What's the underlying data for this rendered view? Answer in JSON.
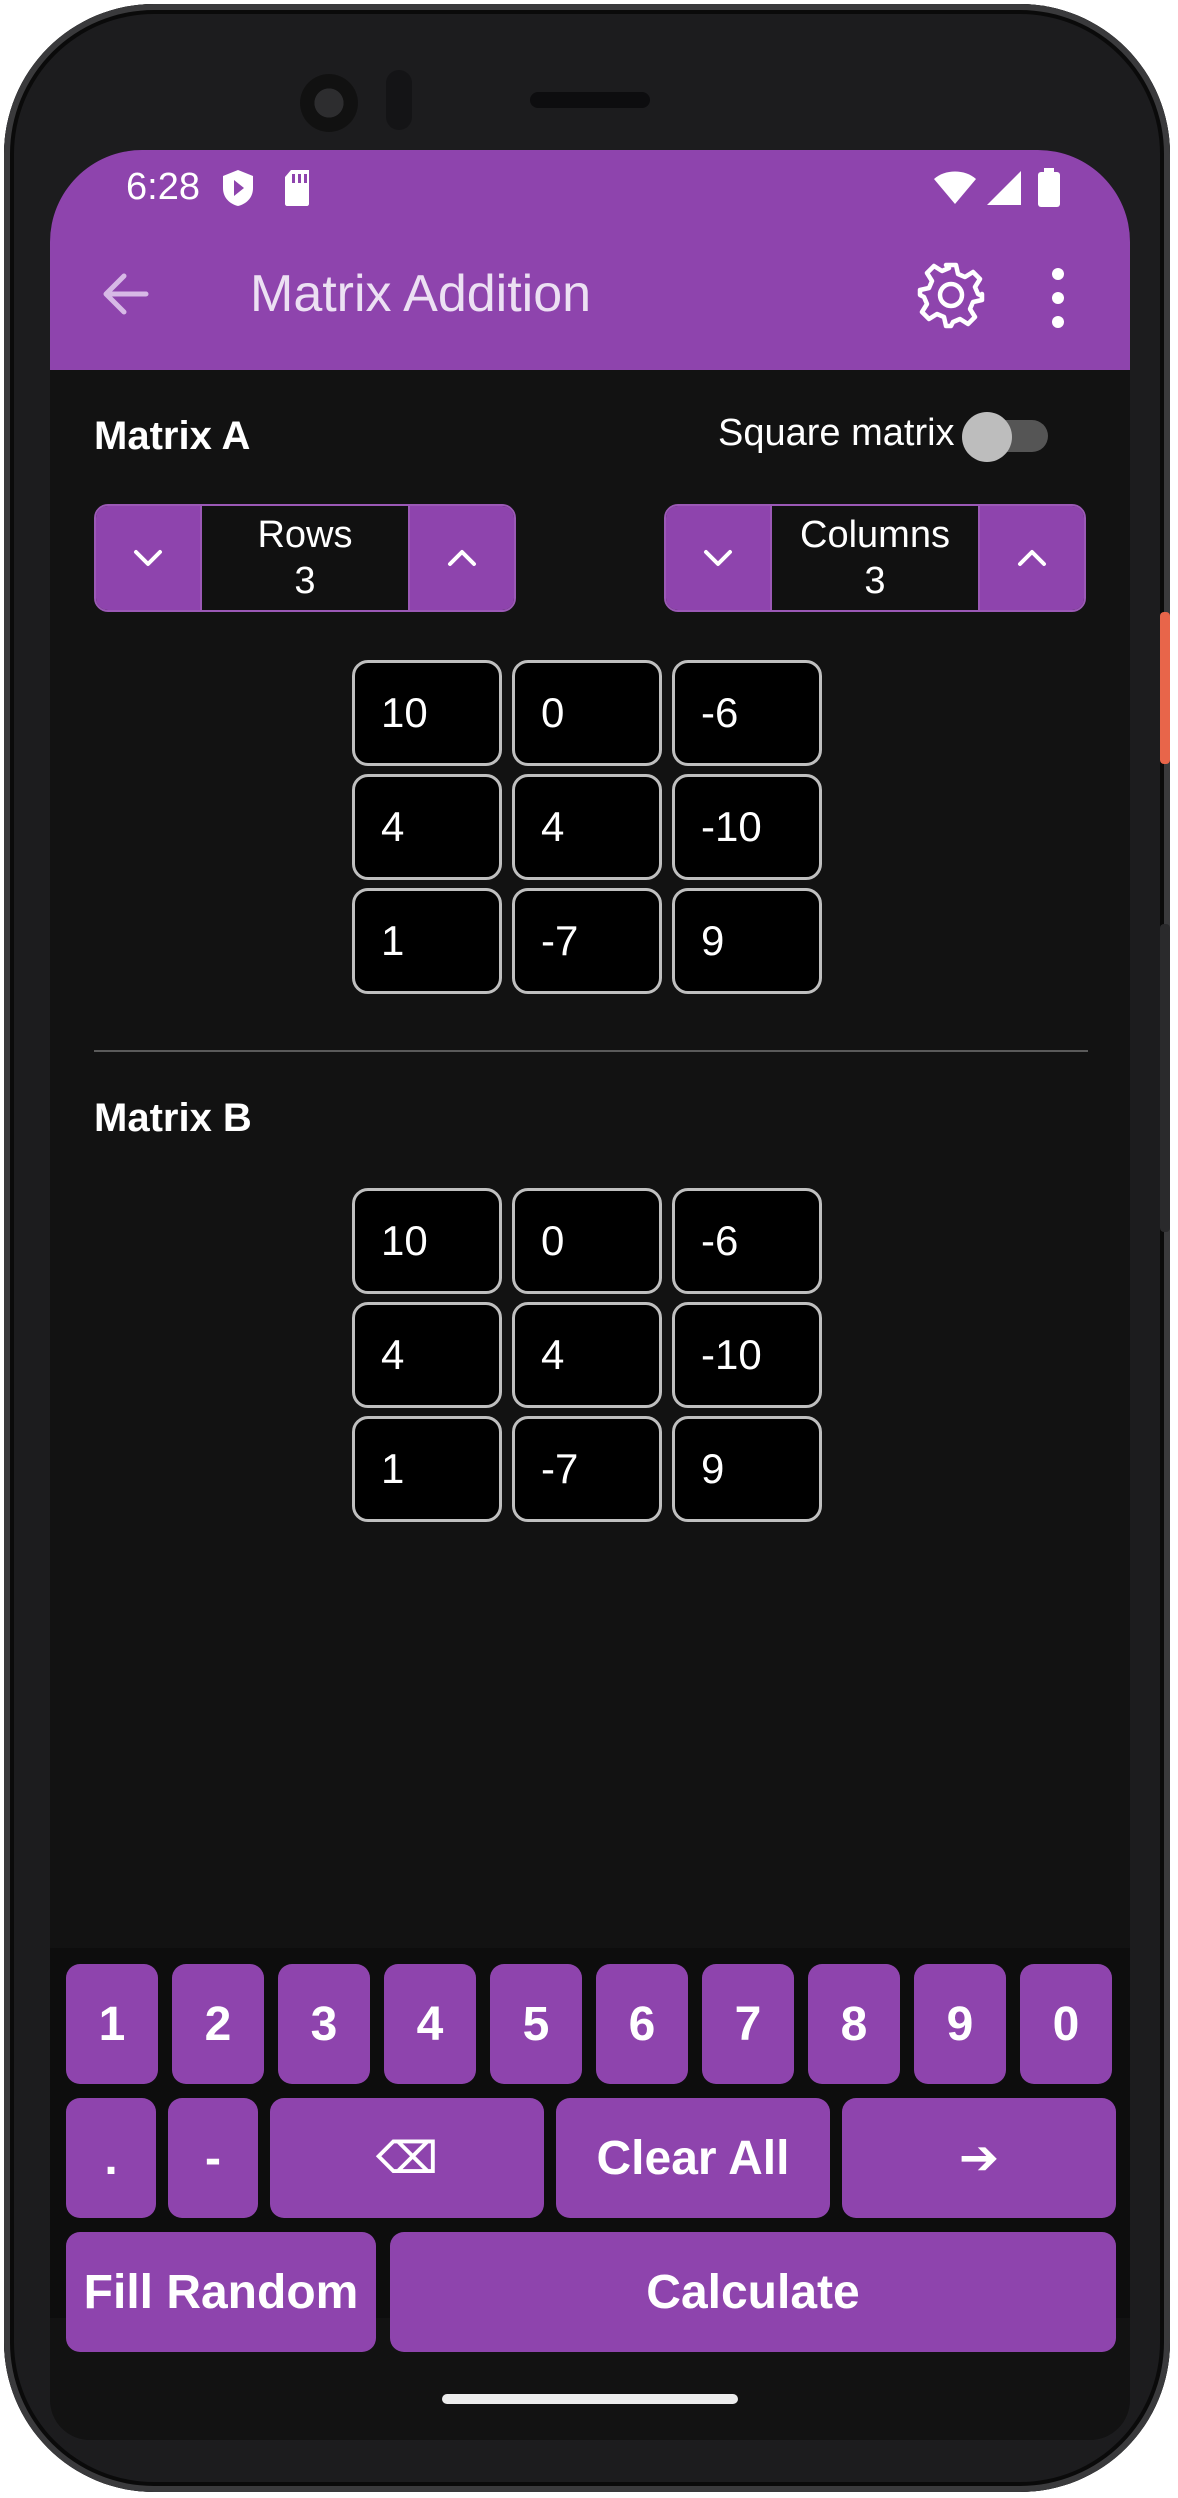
{
  "status_bar": {
    "time": "6:28",
    "icons": [
      "shield-icon",
      "sd-card-icon",
      "wifi-icon",
      "signal-icon",
      "battery-icon"
    ]
  },
  "app_bar": {
    "title": "Matrix Addition",
    "back_icon": "arrow-back-icon",
    "settings_icon": "gear-icon",
    "more_icon": "more-vertical-icon"
  },
  "matrix_a": {
    "label": "Matrix A",
    "square_toggle": {
      "label": "Square matrix",
      "on": false
    },
    "rows": {
      "label": "Rows",
      "value": "3"
    },
    "columns": {
      "label": "Columns",
      "value": "3"
    },
    "cells": [
      [
        "10",
        "0",
        "-6"
      ],
      [
        "4",
        "4",
        "-10"
      ],
      [
        "1",
        "-7",
        "9"
      ]
    ]
  },
  "matrix_b": {
    "label": "Matrix B",
    "cells": [
      [
        "10",
        "0",
        "-6"
      ],
      [
        "4",
        "4",
        "-10"
      ],
      [
        "1",
        "-7",
        "9"
      ]
    ]
  },
  "keypad": {
    "digits": [
      "1",
      "2",
      "3",
      "4",
      "5",
      "6",
      "7",
      "8",
      "9",
      "0"
    ],
    "dot": ".",
    "minus": "-",
    "backspace": "⌫",
    "clear_all": "Clear All",
    "next": "➔",
    "fill_random": "Fill Random",
    "calculate": "Calculate"
  },
  "colors": {
    "accent": "#8e44ad",
    "background": "#121212",
    "cell_border": "#bfbfbf"
  }
}
